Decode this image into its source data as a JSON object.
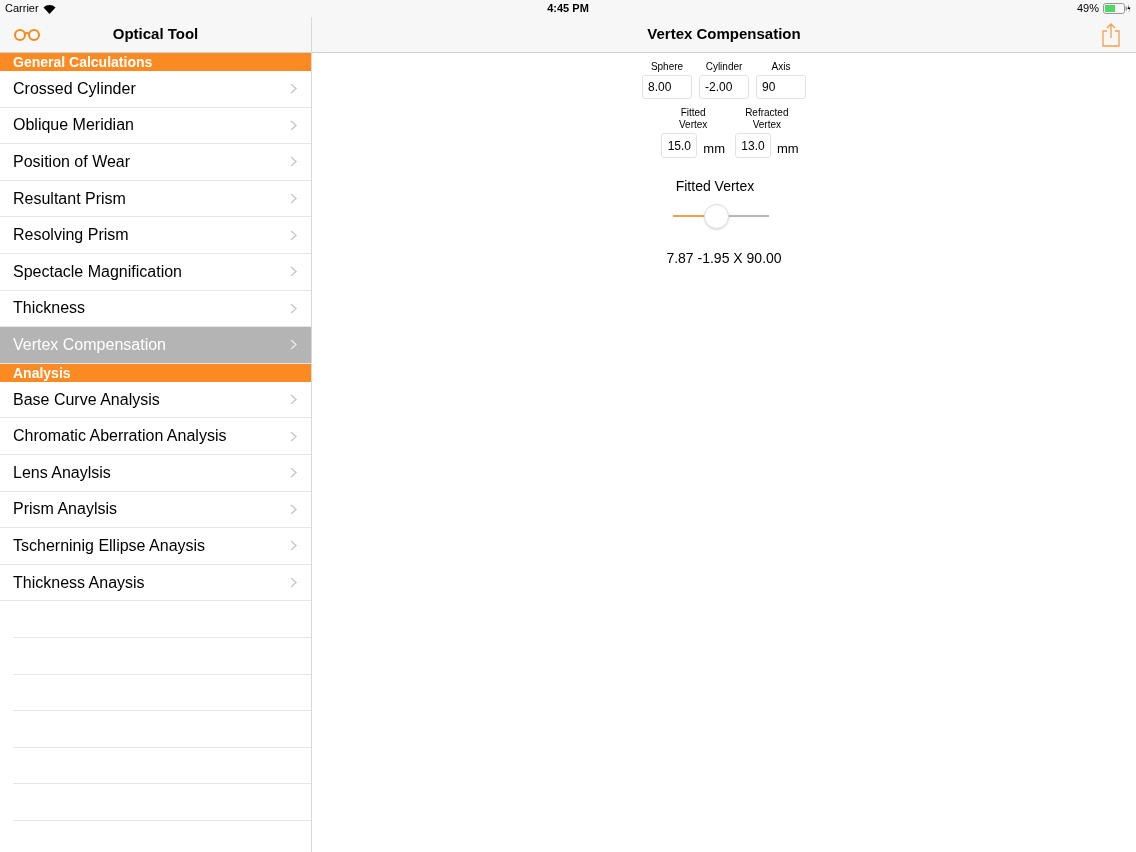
{
  "status_bar": {
    "carrier": "Carrier",
    "time": "4:45 PM",
    "battery": "49%"
  },
  "sidebar": {
    "title": "Optical Tool",
    "sections": [
      {
        "title": "General Calculations",
        "items": [
          {
            "label": "Crossed Cylinder",
            "selected": false
          },
          {
            "label": "Oblique Meridian",
            "selected": false
          },
          {
            "label": "Position of Wear",
            "selected": false
          },
          {
            "label": "Resultant Prism",
            "selected": false
          },
          {
            "label": "Resolving Prism",
            "selected": false
          },
          {
            "label": "Spectacle Magnification",
            "selected": false
          },
          {
            "label": "Thickness",
            "selected": false
          },
          {
            "label": "Vertex Compensation",
            "selected": true
          }
        ]
      },
      {
        "title": "Analysis",
        "items": [
          {
            "label": "Base Curve Analysis",
            "selected": false
          },
          {
            "label": "Chromatic Aberration Analysis",
            "selected": false
          },
          {
            "label": "Lens Anaylsis",
            "selected": false
          },
          {
            "label": "Prism Anaylsis",
            "selected": false
          },
          {
            "label": "Tscherninig Ellipse Anaysis",
            "selected": false
          },
          {
            "label": "Thickness Anaysis",
            "selected": false
          }
        ]
      }
    ]
  },
  "detail": {
    "title": "Vertex Compensation",
    "prescription": [
      {
        "label": "Sphere",
        "value": "8.00"
      },
      {
        "label": "Cylinder",
        "value": "-2.00"
      },
      {
        "label": "Axis",
        "value": "90"
      }
    ],
    "vertex": [
      {
        "label": "Fitted Vertex",
        "value": "15.0",
        "unit": "mm"
      },
      {
        "label": "Refracted Vertex",
        "value": "13.0",
        "unit": "mm"
      }
    ],
    "slider": {
      "label": "Fitted Vertex",
      "level": 0.43
    },
    "result": "7.87 -1.95 X 90.00"
  }
}
